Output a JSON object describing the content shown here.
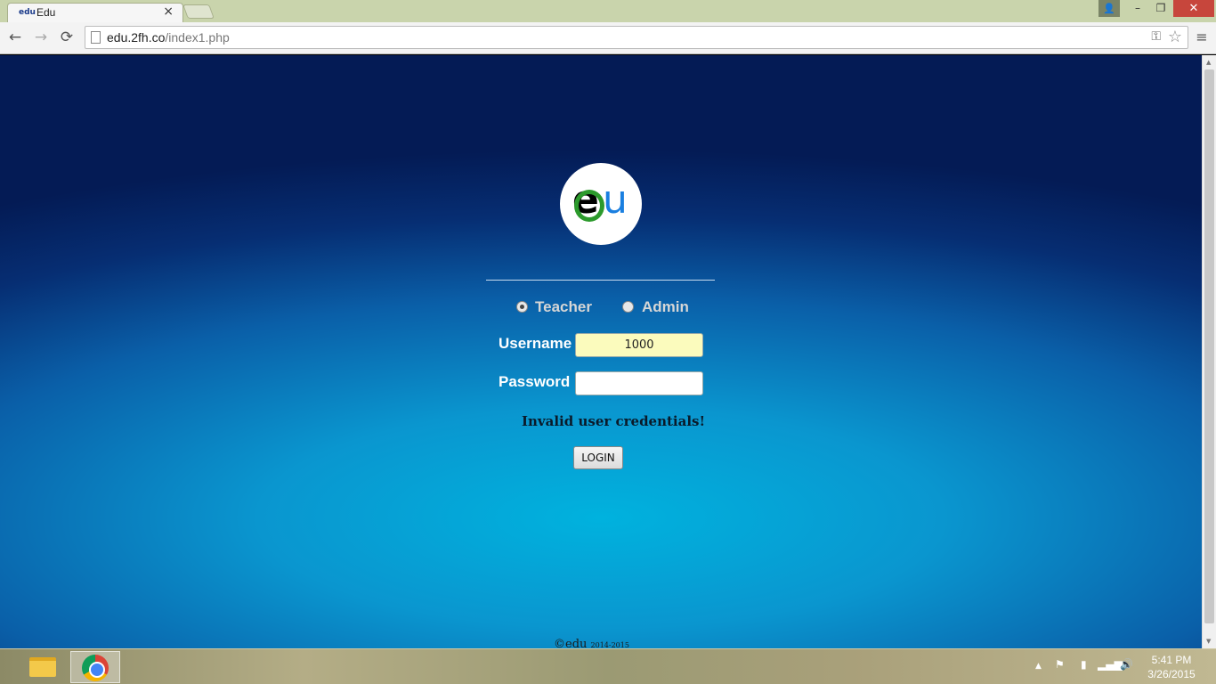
{
  "browser": {
    "tab_title": "Edu",
    "tab_favicon": "edu",
    "url_host": "edu.2fh.co",
    "url_path": "/index1.php",
    "icons": {
      "back": "←",
      "forward": "→",
      "reload": "⟳",
      "menu": "≡",
      "close_tab": "×",
      "star": "☆",
      "key": "⚿",
      "minimize": "–",
      "restore": "❐",
      "close_window": "✕",
      "user": "👤"
    }
  },
  "page": {
    "logo_e": "e",
    "logo_u": "u",
    "roles": [
      {
        "label": "Teacher",
        "checked": true
      },
      {
        "label": "Admin",
        "checked": false
      }
    ],
    "username_label": "Username",
    "username_value": "1000",
    "password_label": "Password",
    "password_value": "",
    "error": "Invalid user credentials!",
    "login_label": "LOGIN",
    "footer_brand": "©edu",
    "footer_years": "2014-2015"
  },
  "taskbar": {
    "tray_up": "▲",
    "time": "5:41 PM",
    "date": "3/26/2015"
  }
}
